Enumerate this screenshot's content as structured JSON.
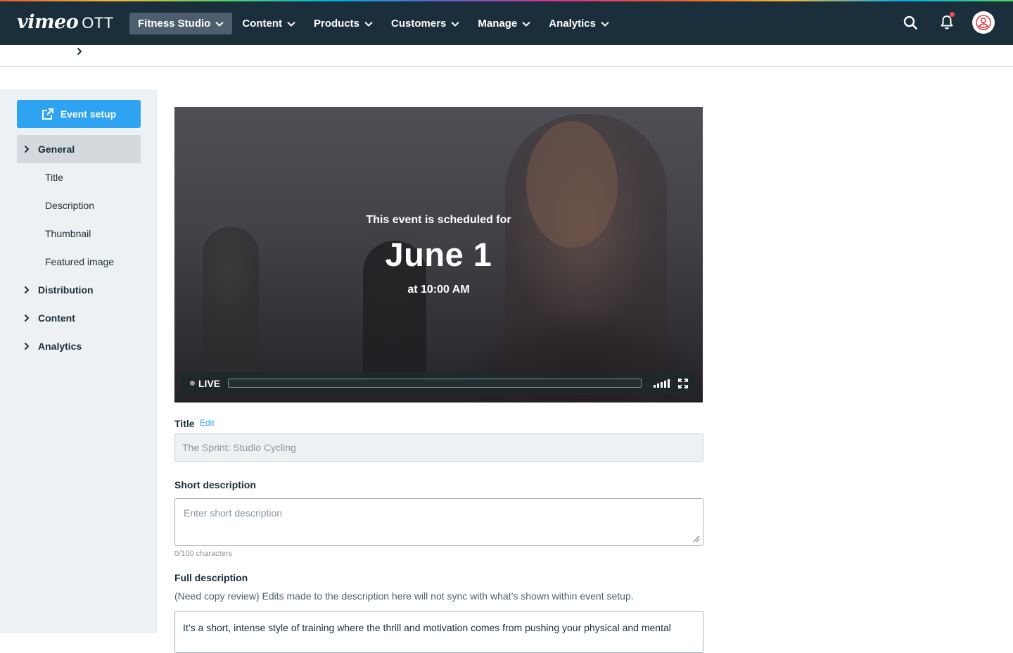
{
  "brand": {
    "logo_main": "vimeo",
    "logo_suffix": "OTT"
  },
  "nav": {
    "items": [
      {
        "label": "Fitness Studio",
        "active": true
      },
      {
        "label": "Content"
      },
      {
        "label": "Products"
      },
      {
        "label": "Customers"
      },
      {
        "label": "Manage"
      },
      {
        "label": "Analytics"
      }
    ],
    "icons": [
      "search-icon",
      "bell-icon",
      "avatar-icon"
    ],
    "notification_dot": true
  },
  "sidebar": {
    "setup_button": "Event setup",
    "sections": [
      {
        "label": "General",
        "active": true,
        "children": [
          "Title",
          "Description",
          "Thumbnail",
          "Featured image"
        ]
      },
      {
        "label": "Distribution"
      },
      {
        "label": "Content"
      },
      {
        "label": "Analytics"
      }
    ]
  },
  "player": {
    "line1": "This event is scheduled for",
    "date": "June 1",
    "time": "at 10:00 AM",
    "live_label": "LIVE"
  },
  "form": {
    "title_label": "Title",
    "edit_label": "Edit",
    "title_value": "The Sprint: Studio Cycling",
    "short_label": "Short description",
    "short_placeholder": "Enter short description",
    "char_count": "0/100 characters",
    "full_label": "Full description",
    "full_note": "(Need copy review) Edits made to the description here will not sync with what’s shown within event setup.",
    "full_value": "It’s a short, intense style of training where the thrill and motivation comes from pushing your physical and mental"
  },
  "colors": {
    "nav_bg": "#1a2e3b",
    "accent": "#2ea3f2",
    "sidebar_bg": "#eef1f3",
    "active_section": "#d4d9dd"
  }
}
